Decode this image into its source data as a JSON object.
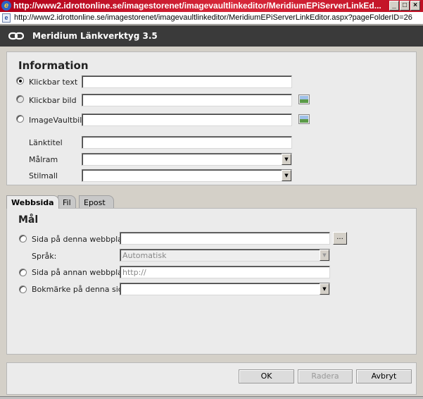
{
  "window": {
    "title": "http://www2.idrottonline.se/imagestorenet/imagevaultlinkeditor/MeridiumEPiServerLinkEd...",
    "address": "http://www2.idrottonline.se/imagestorenet/imagevaultlinkeditor/MeridiumEPiServerLinkEditor.aspx?pageFolderID=26"
  },
  "app": {
    "title": "Meridium Länkverktyg 3.5"
  },
  "information": {
    "heading": "Information",
    "options": [
      {
        "label": "Klickbar text",
        "checked": true,
        "value": ""
      },
      {
        "label": "Klickbar bild",
        "checked": false,
        "value": ""
      },
      {
        "label": "ImageVaultbild",
        "checked": false,
        "value": ""
      }
    ],
    "link_title_label": "Länktitel",
    "link_title_value": "",
    "target_frame_label": "Målram",
    "target_frame_value": "",
    "style_label": "Stilmall",
    "style_value": ""
  },
  "tabs": [
    "Webbsida",
    "Fil",
    "Epost"
  ],
  "target": {
    "heading": "Mål",
    "this_site_label": "Sida på denna webbplats",
    "this_site_value": "",
    "browse_label": "...",
    "language_label": "Språk:",
    "language_value": "Automatisk",
    "other_site_label": "Sida på annan webbplats",
    "other_site_placeholder": "http://",
    "bookmark_label": "Bokmärke på denna sida",
    "bookmark_value": ""
  },
  "buttons": {
    "ok": "OK",
    "remove": "Radera",
    "cancel": "Avbryt"
  }
}
